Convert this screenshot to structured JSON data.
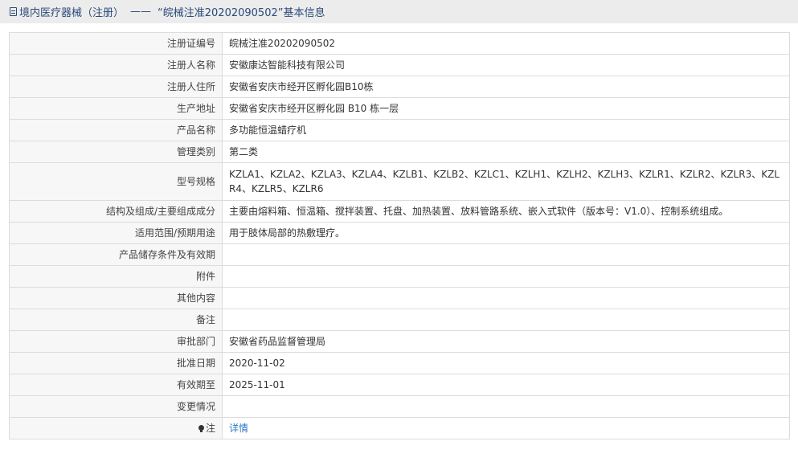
{
  "header": {
    "category": "境内医疗器械（注册）",
    "separator": "——",
    "title": "“皖械注准20202090502”基本信息"
  },
  "rows": [
    {
      "label": "注册证编号",
      "value": "皖械注准20202090502"
    },
    {
      "label": "注册人名称",
      "value": "安徽康达智能科技有限公司"
    },
    {
      "label": "注册人住所",
      "value": "安徽省安庆市经开区孵化园B10栋"
    },
    {
      "label": "生产地址",
      "value": "安徽省安庆市经开区孵化园 B10 栋一层"
    },
    {
      "label": "产品名称",
      "value": "多功能恒温蜡疗机"
    },
    {
      "label": "管理类别",
      "value": "第二类"
    },
    {
      "label": "型号规格",
      "value": "KZLA1、KZLA2、KZLA3、KZLA4、KZLB1、KZLB2、KZLC1、KZLH1、KZLH2、KZLH3、KZLR1、KZLR2、KZLR3、KZLR4、KZLR5、KZLR6"
    },
    {
      "label": "结构及组成/主要组成成分",
      "value": "主要由熔料箱、恒温箱、搅拌装置、托盘、加热装置、放料管路系统、嵌入式软件（版本号：V1.0）、控制系统组成。"
    },
    {
      "label": "适用范围/预期用途",
      "value": "用于肢体局部的热敷理疗。"
    },
    {
      "label": "产品储存条件及有效期",
      "value": ""
    },
    {
      "label": "附件",
      "value": ""
    },
    {
      "label": "其他内容",
      "value": ""
    },
    {
      "label": "备注",
      "value": ""
    },
    {
      "label": "审批部门",
      "value": "安徽省药品监督管理局"
    },
    {
      "label": "批准日期",
      "value": "2020-11-02"
    },
    {
      "label": "有效期至",
      "value": "2025-11-01"
    },
    {
      "label": "变更情况",
      "value": ""
    }
  ],
  "note": {
    "label": "注",
    "icon": "lightbulb-icon",
    "link_text": "详情"
  }
}
